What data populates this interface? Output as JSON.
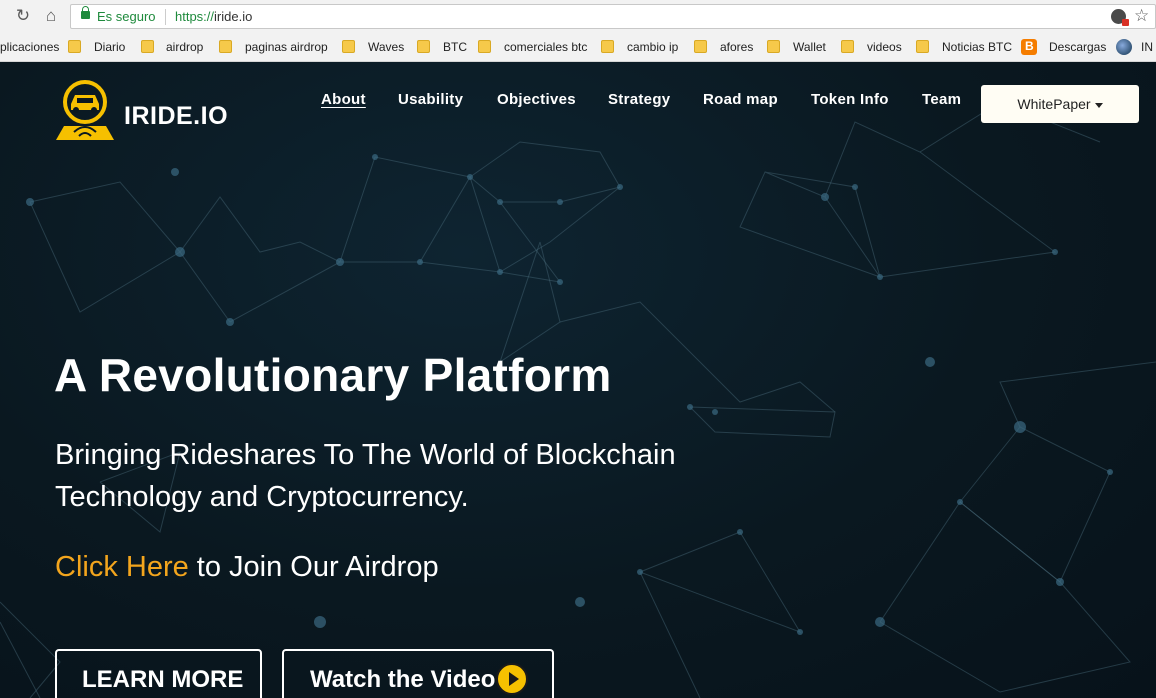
{
  "browser": {
    "security_label": "Es seguro",
    "url_scheme": "https://",
    "url_host": "iride.io",
    "bookmarks": [
      {
        "label": "plicaciones"
      },
      {
        "label": "Diario"
      },
      {
        "label": "airdrop"
      },
      {
        "label": "paginas airdrop"
      },
      {
        "label": "Waves"
      },
      {
        "label": "BTC"
      },
      {
        "label": "comerciales btc"
      },
      {
        "label": "cambio ip"
      },
      {
        "label": "afores"
      },
      {
        "label": "Wallet"
      },
      {
        "label": "videos"
      },
      {
        "label": "Noticias BTC"
      },
      {
        "label": "Descargas"
      },
      {
        "label": "IN"
      }
    ]
  },
  "site": {
    "logo_text": "IRIDE.IO",
    "nav": [
      {
        "label": "About",
        "active": true
      },
      {
        "label": "Usability"
      },
      {
        "label": "Objectives"
      },
      {
        "label": "Strategy"
      },
      {
        "label": "Road map"
      },
      {
        "label": "Token Info"
      },
      {
        "label": "Team"
      }
    ],
    "whitepaper_label": "WhitePaper",
    "hero": {
      "headline": "A Revolutionary Platform",
      "subline": "Bringing Rideshares To The World of Blockchain Technology and Cryptocurrency.",
      "cta_link": "Click Here",
      "cta_rest": " to Join Our Airdrop",
      "learn_more": "LEARN MORE",
      "watch_video": "Watch the Video"
    },
    "colors": {
      "accent": "#f3a51d",
      "logo_yellow": "#f6c000",
      "background": "#0a1820"
    }
  }
}
